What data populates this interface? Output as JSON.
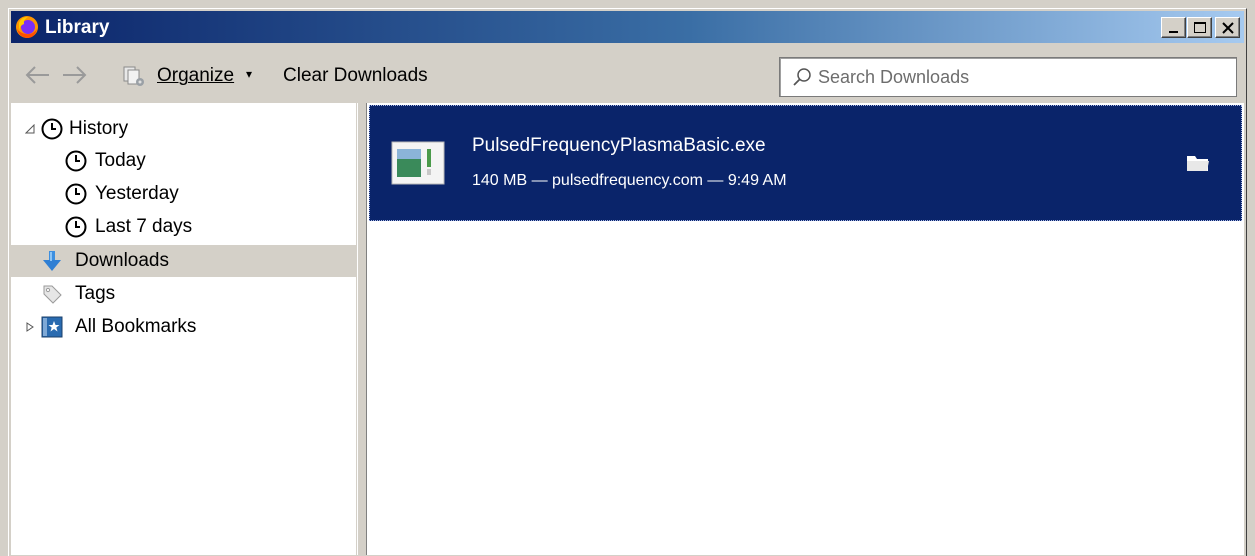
{
  "window": {
    "title": "Library",
    "title_bar_color": "#0b246a",
    "controls": [
      "minimize-icon",
      "maximize-icon",
      "close-icon"
    ]
  },
  "toolbar": {
    "back_icon": "back-arrow-icon",
    "forward_icon": "forward-arrow-icon",
    "organize_icon": "organize-icon",
    "organize_label": "Organize",
    "clear_downloads_label": "Clear Downloads"
  },
  "search": {
    "placeholder": "Search Downloads",
    "value": "",
    "icon": "search-icon"
  },
  "sidebar": {
    "items": [
      {
        "label": "History",
        "icon": "clock-icon",
        "expanded": true
      },
      {
        "label": "Today",
        "icon": "clock-icon"
      },
      {
        "label": "Yesterday",
        "icon": "clock-icon"
      },
      {
        "label": "Last 7 days",
        "icon": "clock-icon"
      },
      {
        "label": "Downloads",
        "icon": "download-arrow-icon",
        "selected": true
      },
      {
        "label": "Tags",
        "icon": "tag-icon"
      },
      {
        "label": "All Bookmarks",
        "icon": "bookmarks-icon",
        "expanded": false
      }
    ]
  },
  "downloads": [
    {
      "filename": "PulsedFrequencyPlasmaBasic.exe",
      "meta": "140 MB — pulsedfrequency.com — 9:49 AM",
      "icon": "executable-file-icon",
      "action_icon": "open-folder-icon",
      "selected": true
    }
  ],
  "colors": {
    "selection": "#0a246a",
    "chrome": "#d4d0c8"
  }
}
